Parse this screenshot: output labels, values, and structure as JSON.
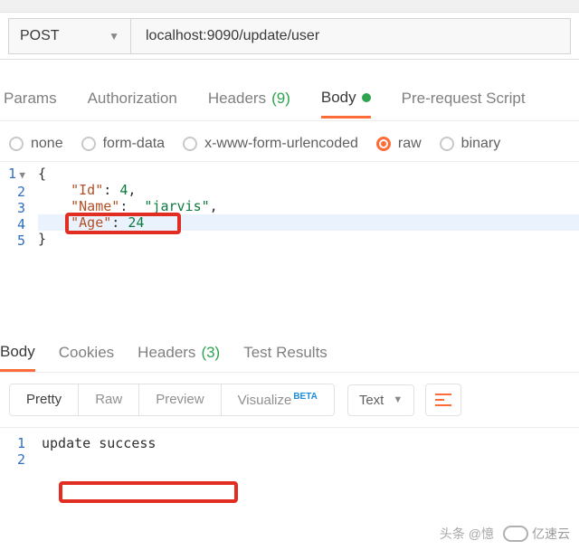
{
  "request": {
    "method": "POST",
    "url": "localhost:9090/update/user"
  },
  "tabs": {
    "params": "Params",
    "authorization": "Authorization",
    "headers": "Headers",
    "headers_count": "(9)",
    "body": "Body",
    "prerequest": "Pre-request Script"
  },
  "body_types": {
    "none": "none",
    "formdata": "form-data",
    "urlencoded": "x-www-form-urlencoded",
    "raw": "raw",
    "binary": "binary"
  },
  "editor": {
    "lines": [
      "1",
      "2",
      "3",
      "4",
      "5"
    ],
    "brace_open": "{",
    "brace_close": "}",
    "id_key": "\"Id\"",
    "id_val": "4",
    "name_key": "\"Name\"",
    "name_val": "\"jarvis\"",
    "age_key": "\"Age\"",
    "age_val": "24",
    "colon": ": ",
    "comma": ","
  },
  "response_tabs": {
    "body": "Body",
    "cookies": "Cookies",
    "headers": "Headers",
    "headers_count": "(3)",
    "test_results": "Test Results"
  },
  "response_toolbar": {
    "pretty": "Pretty",
    "raw": "Raw",
    "preview": "Preview",
    "visualize": "Visualize",
    "beta": "BETA",
    "format": "Text"
  },
  "response_body": {
    "lines": [
      "1",
      "2"
    ],
    "content": "update success"
  },
  "watermark": {
    "toutiao": "头条 @憶",
    "ysy": "亿速云"
  }
}
